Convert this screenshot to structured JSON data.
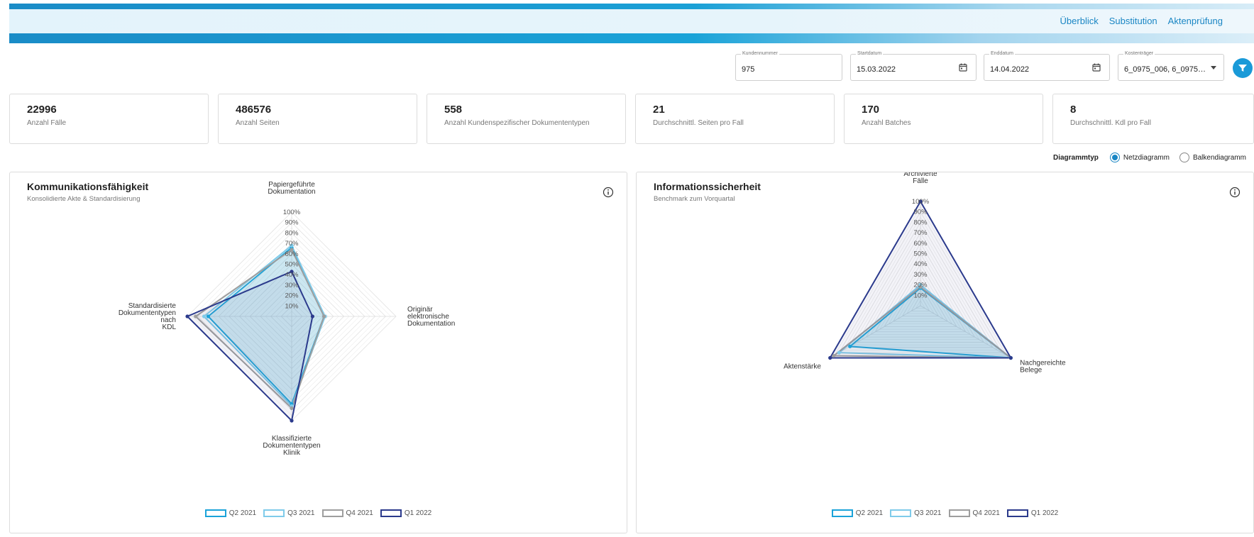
{
  "nav": [
    "Überblick",
    "Substitution",
    "Aktenprüfung"
  ],
  "filters": {
    "kundennummer": {
      "label": "Kundennummer",
      "value": "975"
    },
    "startdatum": {
      "label": "Startdatum",
      "value": "15.03.2022"
    },
    "enddatum": {
      "label": "Enddatum",
      "value": "14.04.2022"
    },
    "kostentraeger": {
      "label": "Kostenträger",
      "value": "6_0975_006, 6_0975_51..."
    }
  },
  "kpis": [
    {
      "value": "22996",
      "label": "Anzahl Fälle"
    },
    {
      "value": "486576",
      "label": "Anzahl Seiten"
    },
    {
      "value": "558",
      "label": "Anzahl Kundenspezifischer Dokumententypen"
    },
    {
      "value": "21",
      "label": "Durchschnittl. Seiten pro Fall"
    },
    {
      "value": "170",
      "label": "Anzahl Batches"
    },
    {
      "value": "8",
      "label": "Durchschnittl. Kdl pro Fall"
    }
  ],
  "chart_type": {
    "label": "Diagrammtyp",
    "options": [
      "Netzdiagramm",
      "Balkendiagramm"
    ],
    "selected": "Netzdiagramm"
  },
  "colors": {
    "accent": "#1a86c4",
    "q2_2021": "#1aa3d9",
    "q3_2021": "#7fcbea",
    "q4_2021": "#9e9e9e",
    "q1_2022": "#2b3a8c"
  },
  "panels": [
    {
      "title": "Kommunikationsfähigkeit",
      "subtitle": "Konsolidierte Akte & Standardisierung"
    },
    {
      "title": "Informationssicherheit",
      "subtitle": "Benchmark zum Vorquartal"
    }
  ],
  "chart_data": [
    {
      "type": "radar",
      "title": "Kommunikationsfähigkeit",
      "axes": [
        {
          "label": [
            "Papiergeführte",
            "Dokumentation"
          ]
        },
        {
          "label": [
            "Originär",
            "elektronische",
            "Dokumentation"
          ]
        },
        {
          "label": [
            "Klassifizierte",
            "Dokumententypen",
            "Klinik"
          ]
        },
        {
          "label": [
            "Standardisierte",
            "Dokumententypen",
            "nach",
            "KDL"
          ]
        }
      ],
      "ticks": [
        "10%",
        "20%",
        "30%",
        "40%",
        "50%",
        "60%",
        "70%",
        "80%",
        "90%",
        "100%"
      ],
      "range": [
        0,
        100
      ],
      "series": [
        {
          "name": "Q2 2021",
          "values": [
            66,
            31,
            84,
            80
          ],
          "color": "#1aa3d9"
        },
        {
          "name": "Q3 2021",
          "values": [
            68,
            32,
            86,
            84
          ],
          "color": "#7fcbea"
        },
        {
          "name": "Q4 2021",
          "values": [
            64,
            31,
            88,
            92
          ],
          "color": "#9e9e9e"
        },
        {
          "name": "Q1 2022",
          "values": [
            43,
            20,
            100,
            100
          ],
          "color": "#2b3a8c"
        }
      ],
      "legend": "bottom"
    },
    {
      "type": "radar",
      "title": "Informationssicherheit",
      "axes": [
        {
          "label": [
            "Archivierte",
            "Fälle"
          ]
        },
        {
          "label": [
            "Nachgereichte",
            "Belege"
          ]
        },
        {
          "label": [
            "Aktenstärke"
          ]
        }
      ],
      "ticks": [
        "10%",
        "20%",
        "30%",
        "40%",
        "50%",
        "60%",
        "70%",
        "80%",
        "90%",
        "100%"
      ],
      "range": [
        0,
        100
      ],
      "series": [
        {
          "name": "Q2 2021",
          "values": [
            17,
            100,
            78
          ],
          "color": "#1aa3d9"
        },
        {
          "name": "Q3 2021",
          "values": [
            20,
            100,
            90
          ],
          "color": "#7fcbea"
        },
        {
          "name": "Q4 2021",
          "values": [
            18,
            100,
            96
          ],
          "color": "#9e9e9e"
        },
        {
          "name": "Q1 2022",
          "values": [
            100,
            100,
            100
          ],
          "color": "#2b3a8c"
        }
      ],
      "legend": "bottom"
    }
  ]
}
